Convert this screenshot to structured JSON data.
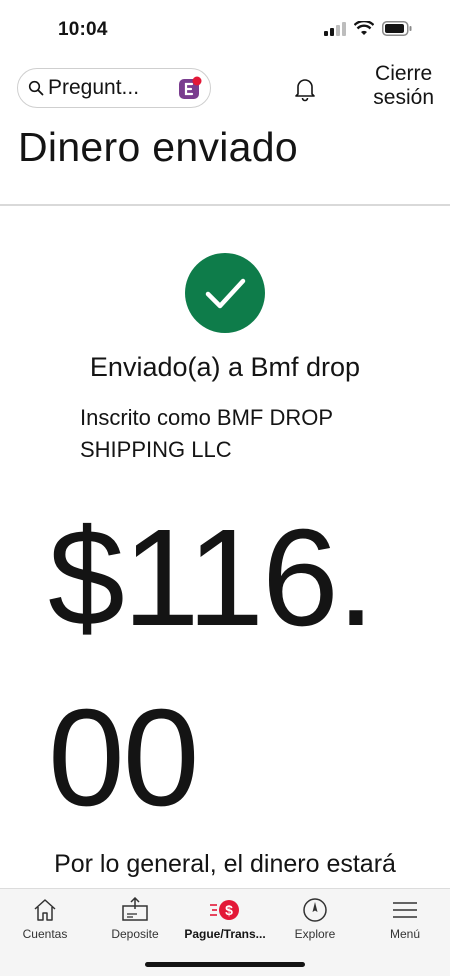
{
  "status": {
    "time": "10:04"
  },
  "header": {
    "search_placeholder": "Pregunt...",
    "logout_line1": "Cierre",
    "logout_line2": "sesión"
  },
  "page": {
    "title": "Dinero enviado"
  },
  "confirmation": {
    "sent_to": "Enviado(a) a Bmf drop",
    "enrolled_as": "Inscrito como BMF DROP SHIPPING LLC",
    "amount": "$116.00",
    "note": "Por lo general, el dinero estará"
  },
  "nav": [
    {
      "label": "Cuentas",
      "icon": "home-icon"
    },
    {
      "label": "Deposite",
      "icon": "deposit-icon"
    },
    {
      "label": "Pague/Trans...",
      "icon": "pay-transfer-icon",
      "active": true
    },
    {
      "label": "Explore",
      "icon": "compass-icon"
    },
    {
      "label": "Menú",
      "icon": "menu-icon"
    }
  ],
  "colors": {
    "success": "#0e7c4a",
    "accent": "#e31837"
  }
}
